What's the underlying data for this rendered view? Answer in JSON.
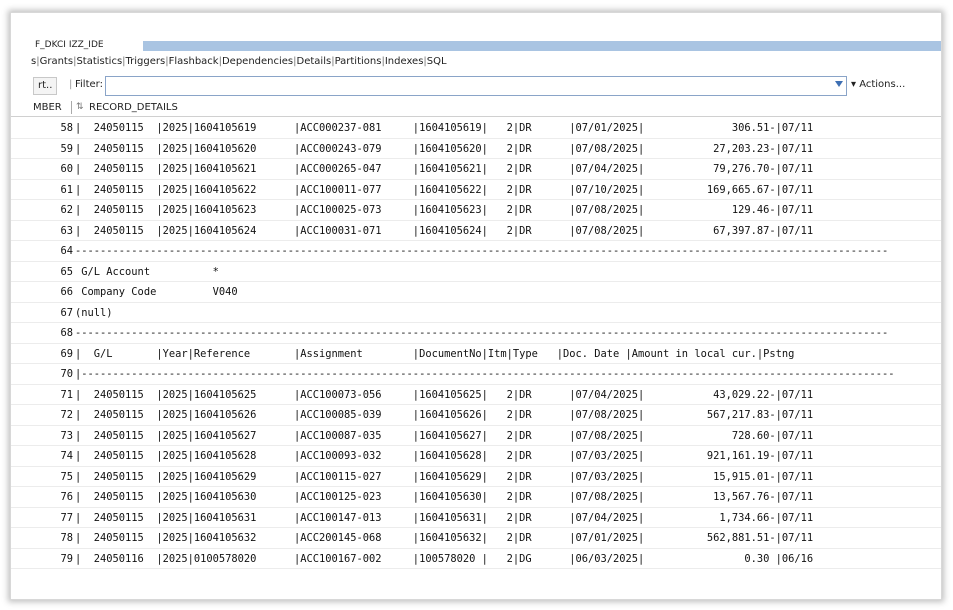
{
  "doc_tab": {
    "label": "F_DKCI IZZ_IDE"
  },
  "subtabs": [
    "s",
    "Grants",
    "Statistics",
    "Triggers",
    "Flashback",
    "Dependencies",
    "Details",
    "Partitions",
    "Indexes",
    "SQL"
  ],
  "toolbar": {
    "sort_label": "rt..",
    "filter_label": "Filter:",
    "filter_value": "",
    "actions_label": "▾ Actions..."
  },
  "columns": {
    "number": "MBER",
    "record_details": "RECORD_DETAILS"
  },
  "rows": [
    {
      "n": "58",
      "d": "|  24050115  |2025|1604105619      |ACC000237-081     |1604105619|   2|DR      |07/01/2025|              306.51-|07/11"
    },
    {
      "n": "59",
      "d": "|  24050115  |2025|1604105620      |ACC000243-079     |1604105620|   2|DR      |07/08/2025|           27,203.23-|07/11"
    },
    {
      "n": "60",
      "d": "|  24050115  |2025|1604105621      |ACC000265-047     |1604105621|   2|DR      |07/04/2025|           79,276.70-|07/11"
    },
    {
      "n": "61",
      "d": "|  24050115  |2025|1604105622      |ACC100011-077     |1604105622|   2|DR      |07/10/2025|          169,665.67-|07/11"
    },
    {
      "n": "62",
      "d": "|  24050115  |2025|1604105623      |ACC100025-073     |1604105623|   2|DR      |07/08/2025|              129.46-|07/11"
    },
    {
      "n": "63",
      "d": "|  24050115  |2025|1604105624      |ACC100031-071     |1604105624|   2|DR      |07/08/2025|           67,397.87-|07/11"
    },
    {
      "n": "64",
      "d": "----------------------------------------------------------------------------------------------------------------------------------"
    },
    {
      "n": "65",
      "d": " G/L Account          *"
    },
    {
      "n": "66",
      "d": " Company Code         V040"
    },
    {
      "n": "67",
      "d": "(null)"
    },
    {
      "n": "68",
      "d": "----------------------------------------------------------------------------------------------------------------------------------"
    },
    {
      "n": "69",
      "d": "|  G/L       |Year|Reference       |Assignment        |DocumentNo|Itm|Type   |Doc. Date |Amount in local cur.|Pstng"
    },
    {
      "n": "70",
      "d": "|----------------------------------------------------------------------------------------------------------------------------------"
    },
    {
      "n": "71",
      "d": "|  24050115  |2025|1604105625      |ACC100073-056     |1604105625|   2|DR      |07/04/2025|           43,029.22-|07/11"
    },
    {
      "n": "72",
      "d": "|  24050115  |2025|1604105626      |ACC100085-039     |1604105626|   2|DR      |07/08/2025|          567,217.83-|07/11"
    },
    {
      "n": "73",
      "d": "|  24050115  |2025|1604105627      |ACC100087-035     |1604105627|   2|DR      |07/08/2025|              728.60-|07/11"
    },
    {
      "n": "74",
      "d": "|  24050115  |2025|1604105628      |ACC100093-032     |1604105628|   2|DR      |07/03/2025|          921,161.19-|07/11"
    },
    {
      "n": "75",
      "d": "|  24050115  |2025|1604105629      |ACC100115-027     |1604105629|   2|DR      |07/03/2025|           15,915.01-|07/11"
    },
    {
      "n": "76",
      "d": "|  24050115  |2025|1604105630      |ACC100125-023     |1604105630|   2|DR      |07/08/2025|           13,567.76-|07/11"
    },
    {
      "n": "77",
      "d": "|  24050115  |2025|1604105631      |ACC100147-013     |1604105631|   2|DR      |07/04/2025|            1,734.66-|07/11"
    },
    {
      "n": "78",
      "d": "|  24050115  |2025|1604105632      |ACC200145-068     |1604105632|   2|DR      |07/01/2025|          562,881.51-|07/11"
    },
    {
      "n": "79",
      "d": "|  24050116  |2025|0100578020      |ACC100167-002     |100578020 |   2|DG      |06/03/2025|                0.30 |06/16"
    }
  ]
}
